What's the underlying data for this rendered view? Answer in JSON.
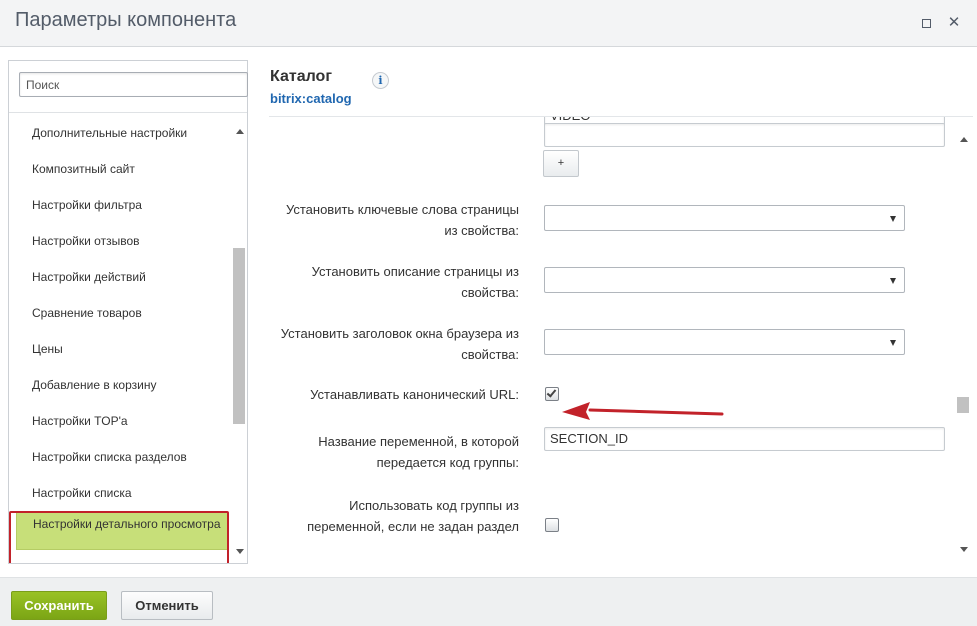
{
  "window": {
    "title": "Параметры компонента",
    "maximize_icon": "maximize-icon",
    "close_icon": "close-icon",
    "close_glyph": "✕"
  },
  "sidebar": {
    "search_placeholder": "Поиск",
    "items": [
      {
        "label": "Дополнительные настройки"
      },
      {
        "label": "Композитный сайт"
      },
      {
        "label": "Настройки фильтра"
      },
      {
        "label": "Настройки отзывов"
      },
      {
        "label": "Настройки действий"
      },
      {
        "label": "Сравнение товаров"
      },
      {
        "label": "Цены"
      },
      {
        "label": "Добавление в корзину"
      },
      {
        "label": "Настройки TOP'а"
      },
      {
        "label": "Настройки списка разделов"
      },
      {
        "label": "Настройки списка"
      },
      {
        "label": "Настройки детального просмотра",
        "active": true
      }
    ]
  },
  "component": {
    "title": "Каталог",
    "id": "bitrix:catalog",
    "info_icon": "i"
  },
  "form": {
    "top_input_value": "VIDEO",
    "add_button": "+",
    "fields": [
      {
        "label_lines": [
          "Установить ключевые слова страницы",
          "из свойства:"
        ],
        "type": "select",
        "value": ""
      },
      {
        "label_lines": [
          "Установить описание страницы из",
          "свойства:"
        ],
        "type": "select",
        "value": ""
      },
      {
        "label_lines": [
          "Установить заголовок окна браузера из",
          "свойства:"
        ],
        "type": "select",
        "value": ""
      },
      {
        "label_lines": [
          "Устанавливать канонический URL:"
        ],
        "type": "checkbox",
        "checked": true
      },
      {
        "label_lines": [
          "Название переменной, в которой",
          "передается код группы:"
        ],
        "type": "text",
        "value": "SECTION_ID"
      },
      {
        "label_lines": [
          "Использовать код группы из",
          "переменной, если не задан раздел"
        ],
        "type": "checkbox",
        "checked": false
      }
    ]
  },
  "footer": {
    "save_label": "Сохранить",
    "cancel_label": "Отменить"
  },
  "colors": {
    "accent": "#2067b0",
    "save_button": "#8ab41f",
    "active_item": "#c7df79",
    "annotation_red": "#c2222a"
  }
}
